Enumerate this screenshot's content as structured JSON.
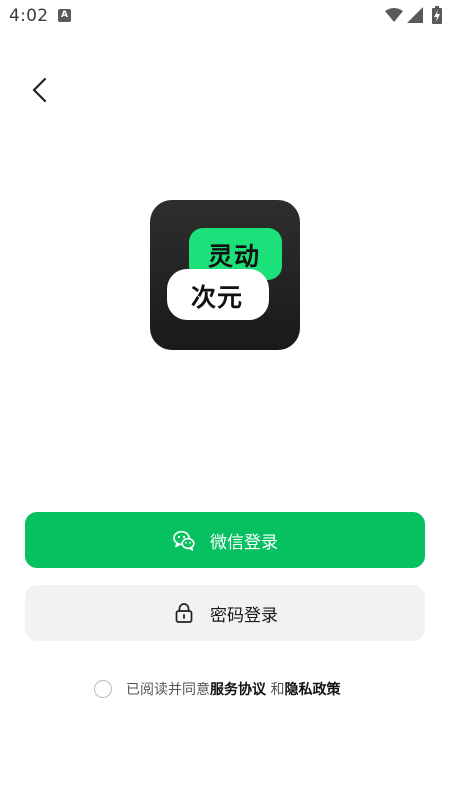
{
  "status_bar": {
    "time": "4:02",
    "notification_icon": "a-letter-icon",
    "notification_letter": "A",
    "icons": [
      "wifi-icon",
      "signal-icon",
      "battery-charging-icon"
    ]
  },
  "nav": {
    "back_icon": "chevron-left-icon"
  },
  "logo": {
    "top_text": "灵动",
    "bottom_text": "次元",
    "accent_color": "#1ce07a",
    "background_color": "#222222"
  },
  "login": {
    "wechat_label": "微信登录",
    "wechat_icon": "wechat-icon",
    "wechat_color": "#07c160",
    "password_label": "密码登录",
    "password_icon": "lock-icon"
  },
  "agreement": {
    "checked": false,
    "prefix": "已阅读并同意",
    "service_link": "服务协议",
    "conjunction": " 和",
    "privacy_link": "隐私政策"
  }
}
